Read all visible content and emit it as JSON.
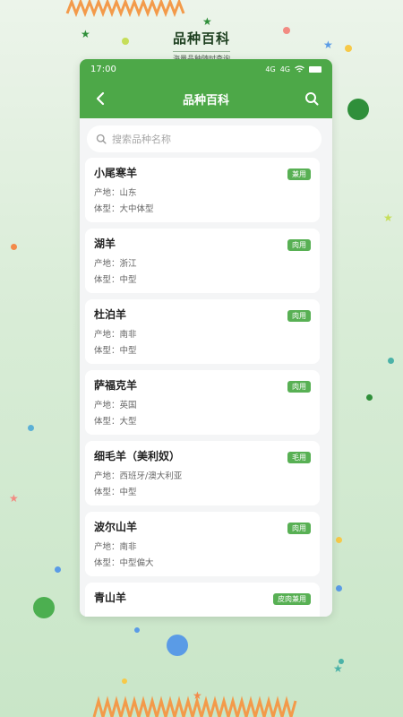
{
  "hero": {
    "title": "品种百科",
    "subtitle": "海量品种随时查询"
  },
  "status_bar": {
    "time": "17:00",
    "network_1": "4G",
    "network_2": "4G"
  },
  "app_bar": {
    "title": "品种百科"
  },
  "search": {
    "placeholder": "搜索品种名称",
    "value": ""
  },
  "breeds": [
    {
      "name": "小尾寒羊",
      "origin": "产地：山东",
      "size": "体型：大中体型",
      "tag": "兼用"
    },
    {
      "name": "湖羊",
      "origin": "产地：浙江",
      "size": "体型：中型",
      "tag": "肉用"
    },
    {
      "name": "杜泊羊",
      "origin": "产地：南非",
      "size": "体型：中型",
      "tag": "肉用"
    },
    {
      "name": "萨福克羊",
      "origin": "产地：英国",
      "size": "体型：大型",
      "tag": "肉用"
    },
    {
      "name": "细毛羊（美利奴）",
      "origin": "产地：西班牙/澳大利亚",
      "size": "体型：中型",
      "tag": "毛用"
    },
    {
      "name": "波尔山羊",
      "origin": "产地：南非",
      "size": "体型：中型偏大",
      "tag": "肉用"
    },
    {
      "name": "青山羊",
      "origin": "",
      "size": "",
      "tag": "皮肉兼用"
    }
  ],
  "colors": {
    "primary": "#4da848",
    "tag": "#58b054",
    "zigzag": "#f39a4a"
  },
  "icons": {
    "back": "chevron-left-icon",
    "search": "search-icon"
  }
}
